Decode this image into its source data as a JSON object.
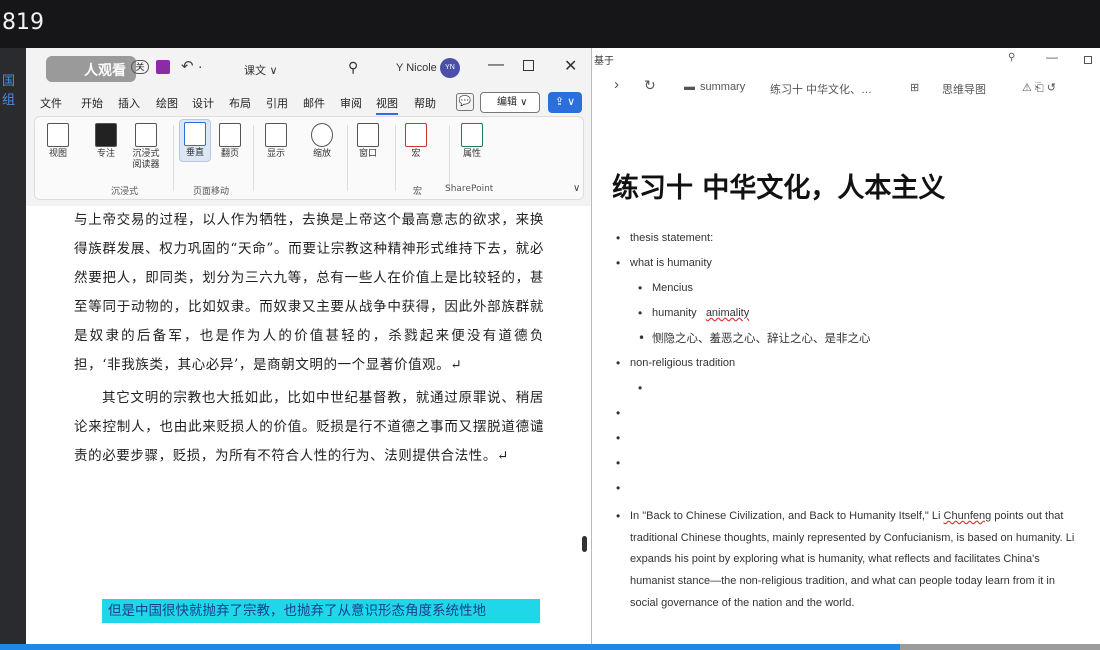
{
  "overlay": {
    "counter": "819",
    "left_label": "国组"
  },
  "word": {
    "watermark": "人观看",
    "toggle": "关",
    "undo": "↶ ·",
    "doc_name": "课文 ∨",
    "user_name": "Y Nicole",
    "avatar": "YN",
    "window": {
      "minimize": "—",
      "close": "✕"
    },
    "menu": [
      "文件",
      "开始",
      "插入",
      "绘图",
      "设计",
      "布局",
      "引用",
      "邮件",
      "审阅",
      "视图",
      "帮助"
    ],
    "active_menu": "视图",
    "comment": "💬",
    "edit_label": "编辑 ∨",
    "share": "⇪ ∨",
    "ribbon": {
      "btn_view": "视图",
      "btn_focus": "专注",
      "btn_reader": "沉浸式\n阅读器",
      "btn_vertical": "垂直",
      "btn_pages": "翻页",
      "btn_show": "显示",
      "btn_zoom": "缩放",
      "btn_window": "窗口",
      "btn_macro": "宏",
      "btn_props": "属性",
      "group_immersive": "沉浸式",
      "group_page_move": "页面移动",
      "group_macro": "宏",
      "group_sharepoint": "SharePoint",
      "collapse": "∨"
    },
    "body_para1": "与上帝交易的过程，以人作为牺牲，去换是上帝这个最高意志的欲求，来换得族群发展、权力巩固的“天命”。而要让宗教这种精神形式维持下去，就必然要把人，即同类，划分为三六九等，总有一些人在价值上是比较轻的，甚至等同于动物的，比如奴隶。而奴隶又主要从战争中获得，因此外部族群就是奴隶的后备军，也是作为人的价值甚轻的，杀戮起来便没有道德负担，‘非我族类，其心必异’，是商朝文明的一个显著价值观。↵",
    "body_para2": "其它文明的宗教也大抵如此，比如中世纪基督教，就通过原罪说、稍居论来控制人，也由此来贬损人的价值。贬损是行不道德之事而又摆脱道德谴责的必要步骤，贬损，为所有不符合人性的行为、法则提供合法性。↵",
    "highlight": "但是中国很快就抛弃了宗教，也抛弃了从意识形态角度系统性地"
  },
  "notes": {
    "top_fragment": "基于",
    "pin": "⚲",
    "min": "—",
    "nav": {
      "forward": "›",
      "refresh": "↻",
      "folder": "summary",
      "crumb": "练习十 中华文化、…",
      "mindmap": "思维导图",
      "icons": "⚠ ⎗ ↺"
    },
    "title": "练习十 中华文化，人本主义",
    "items": {
      "thesis": "thesis statement:",
      "humanity": "what is humanity",
      "mencius": "Mencius",
      "humanity2": "humanity",
      "animality": "animality",
      "four_hearts": "恻隐之心、羞恶之心、辞让之心、是非之心",
      "nonrel": "non-religious tradition"
    },
    "paragraph_pre": "In \"Back to Chinese Civilization, and Back to Humanity Itself,\" Li ",
    "paragraph_name": "Chunfeng",
    "paragraph_post": " points out that traditional Chinese thoughts, mainly represented by Confucianism, is based on humanity. Li expands his point by exploring what is humanity, what reflects and facilitates China's humanist stance—the non-religious tradition, and what can people today learn from it in social governance of the nation and the world."
  }
}
